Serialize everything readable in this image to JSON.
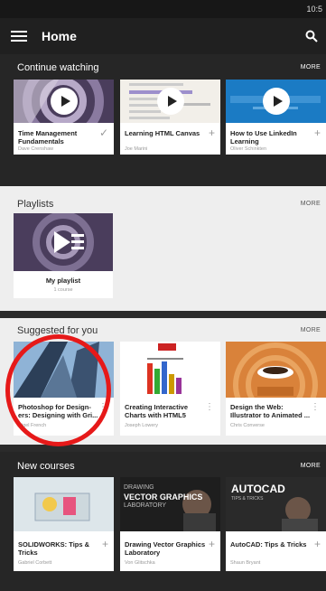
{
  "status_bar": {
    "time": "10:5"
  },
  "app_bar": {
    "title": "Home"
  },
  "continue_watching": {
    "title": "Continue watching",
    "more": "MORE",
    "cards": [
      {
        "title": "Time Management Fundamentals",
        "author": "Dave Crenshaw",
        "action_icon": "checkmark-icon",
        "action": "✓"
      },
      {
        "title": "Learning HTML Canvas",
        "author": "Joe Marini",
        "action_icon": "plus-icon",
        "action": "+"
      },
      {
        "title": "How to Use LinkedIn Learning",
        "author": "Oliver Schinkten",
        "action_icon": "plus-icon",
        "action": "+"
      }
    ]
  },
  "playlists": {
    "title": "Playlists",
    "more": "MORE",
    "card": {
      "name": "My playlist",
      "count": "1 course"
    }
  },
  "suggested": {
    "title": "Suggested for you",
    "more": "MORE",
    "cards": [
      {
        "title": "Photoshop for Design- ers: Designing with Gri...",
        "author": "Nigel French"
      },
      {
        "title": "Creating Interactive Charts with HTML5",
        "author": "Joseph Lowery"
      },
      {
        "title": "Design the Web: Illustrator to Animated ...",
        "author": "Chris Converse"
      }
    ]
  },
  "new_courses": {
    "title": "New courses",
    "more": "MORE",
    "cards": [
      {
        "title": "SOLIDWORKS: Tips & Tricks",
        "author": "Gabriel Corbett",
        "action": "+"
      },
      {
        "title": "Drawing Vector Graphics Laboratory",
        "author": "Von Glitschka",
        "action": "+",
        "thumb_text": [
          "DRAWING",
          "VECTOR GRAPHICS",
          "LABORATORY"
        ]
      },
      {
        "title": "AutoCAD: Tips & Tricks",
        "author": "Shaun Bryant",
        "action": "+",
        "thumb_text": [
          "AUTOCAD",
          "TIPS & TRICKS"
        ]
      }
    ]
  },
  "colors": {
    "annotation_circle": "#e61919",
    "dark_bg": "#262626",
    "light_bg": "#eeeeee"
  }
}
